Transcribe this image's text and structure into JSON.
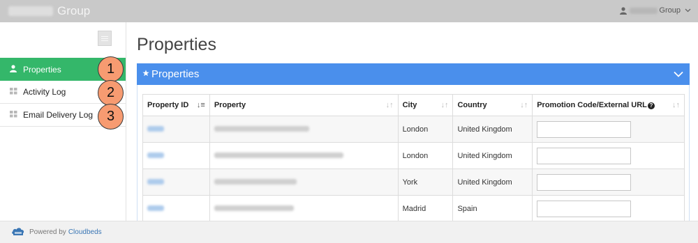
{
  "header": {
    "brand_suffix": "Group",
    "user_suffix": "Group",
    "user_icon": "user-icon",
    "chevron_icon": "chevron-down-icon"
  },
  "sidebar": {
    "items": [
      {
        "label": "Properties",
        "icon": "user-icon",
        "active": true,
        "callout": "1"
      },
      {
        "label": "Activity Log",
        "icon": "grid-icon",
        "active": false,
        "callout": "2"
      },
      {
        "label": "Email Delivery Log",
        "icon": "grid-icon",
        "active": false,
        "callout": "3"
      }
    ]
  },
  "main": {
    "title": "Properties",
    "panel": {
      "title": "Properties",
      "icon": "star-icon"
    },
    "table": {
      "columns": [
        "Property ID",
        "Property",
        "City",
        "Country",
        "Promotion Code/External URL"
      ],
      "rows": [
        {
          "city": "London",
          "country": "United Kingdom",
          "promo": ""
        },
        {
          "city": "London",
          "country": "United Kingdom",
          "promo": ""
        },
        {
          "city": "York",
          "country": "United Kingdom",
          "promo": ""
        },
        {
          "city": "Madrid",
          "country": "Spain",
          "promo": ""
        }
      ]
    }
  },
  "footer": {
    "powered_by": "Powered by",
    "brand": "Cloudbeds"
  },
  "colors": {
    "accent_green": "#34b76a",
    "panel_blue": "#4a8fec",
    "callout_orange": "#f79b71"
  }
}
